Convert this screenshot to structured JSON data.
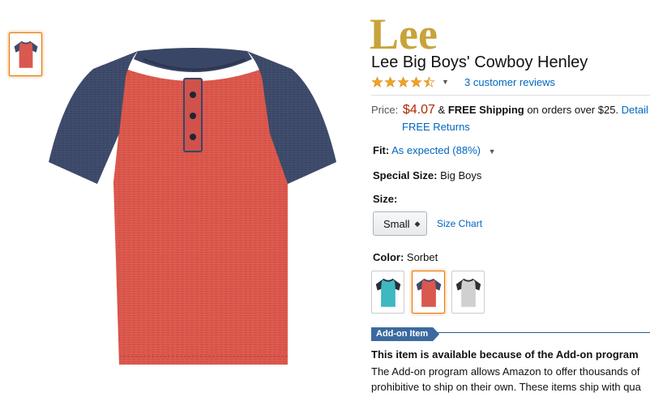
{
  "brand": {
    "logo_text": "Lee"
  },
  "product": {
    "title": "Lee Big Boys' Cowboy Henley",
    "rating_value": 4.5,
    "reviews_link": "3 customer reviews"
  },
  "price": {
    "label": "Price:",
    "amount": "$4.07",
    "connector": " & ",
    "shipping_bold": "FREE Shipping",
    "shipping_rest": " on orders over $25. ",
    "details_link": "Detail",
    "free_returns": "FREE Returns"
  },
  "fit": {
    "label": "Fit:",
    "value": "As expected (88%)"
  },
  "special_size": {
    "label": "Special Size:",
    "value": "Big Boys"
  },
  "size": {
    "label": "Size:",
    "selected": "Small",
    "chart_link": "Size Chart"
  },
  "color": {
    "label": "Color:",
    "value": "Sorbet"
  },
  "swatches": [
    {
      "name": "turquoise",
      "body": "#3fb8c0",
      "sleeve": "#2b2d3a"
    },
    {
      "name": "sorbet",
      "body": "#d9584f",
      "sleeve": "#3d4a6b"
    },
    {
      "name": "heather-grey",
      "body": "#d0d0d0",
      "sleeve": "#2f3033"
    }
  ],
  "addon": {
    "badge": "Add-on Item",
    "heading": "This item is available because of the Add-on program",
    "line1": "The Add-on program allows Amazon to offer thousands of",
    "line2": "prohibitive to ship on their own. These items ship with qua"
  },
  "colors": {
    "link": "#0066c0",
    "price": "#b12704",
    "logo": "#c7a43a",
    "accent": "#e77600"
  }
}
